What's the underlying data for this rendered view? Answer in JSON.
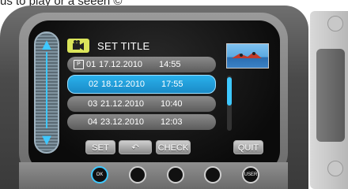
{
  "caption": "us to play or a seeen ©",
  "header": {
    "title": "SET TITLE"
  },
  "rows": [
    {
      "num": "01",
      "date": "17.12.2010",
      "time": "14:55"
    },
    {
      "num": "02",
      "date": "18.12.2010",
      "time": "17:55"
    },
    {
      "num": "03",
      "date": "21.12.2010",
      "time": "10:40"
    },
    {
      "num": "04",
      "date": "23.12.2010",
      "time": "12:03"
    }
  ],
  "buttons": {
    "set": "SET",
    "back": "↶",
    "check": "CHECK",
    "quit": "QUIT"
  },
  "circle_labels": {
    "ok": "OK",
    "user": "USER"
  },
  "colors": {
    "accent": "#2ab1ec",
    "icon_yellow": "#dbe55a"
  }
}
